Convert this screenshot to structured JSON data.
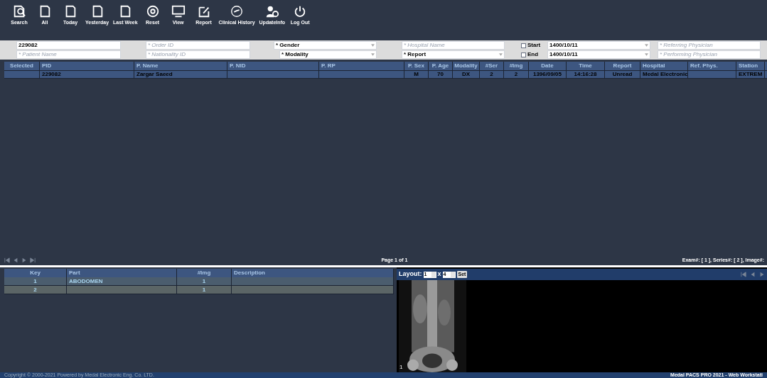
{
  "toolbar": [
    {
      "label": "Search"
    },
    {
      "label": "All"
    },
    {
      "label": "Today"
    },
    {
      "label": "Yesterday"
    },
    {
      "label": "Last Week"
    },
    {
      "label": "Reset"
    },
    {
      "label": "View"
    },
    {
      "label": "Report"
    },
    {
      "label": "Clinical History"
    },
    {
      "label": "UpdateInfo"
    },
    {
      "label": "Log Out"
    }
  ],
  "filters": {
    "row1": [
      {
        "kind": "text",
        "value": "229082"
      },
      {
        "kind": "text",
        "placeholder": "* Order ID"
      },
      {
        "kind": "select",
        "value": "* Gender"
      },
      {
        "kind": "text",
        "placeholder": "* Hospital Name"
      },
      {
        "kind": "date",
        "label": "Start",
        "checked": false,
        "value": "1400/10/11"
      },
      {
        "kind": "text",
        "placeholder": "* Referring Physician"
      }
    ],
    "row2": [
      {
        "kind": "text",
        "placeholder": "* Patient Name"
      },
      {
        "kind": "text",
        "placeholder": "* Nationality ID"
      },
      {
        "kind": "select",
        "value": "* Modality"
      },
      {
        "kind": "select",
        "value": "* Report"
      },
      {
        "kind": "date",
        "label": "End",
        "checked": false,
        "value": "1400/10/11"
      },
      {
        "kind": "text",
        "placeholder": "* Performing Physician"
      }
    ]
  },
  "studies": {
    "columns": [
      "Selected",
      "PID",
      "P. Name",
      "P. NID",
      "P. RP",
      "P. Sex",
      "P. Age",
      "Modality",
      "#Ser",
      "#Img",
      "Date",
      "Time",
      "Report",
      "Hospital",
      "Ref. Phys.",
      "Station"
    ],
    "rows": [
      {
        "selected": false,
        "cells": [
          "",
          "229082",
          "Zargar Saeed",
          "",
          "",
          "M",
          "70",
          "DX",
          "2",
          "2",
          "1396/09/05",
          "14:16:28",
          "Unread",
          "Medal Electronic",
          "",
          "EXTREM"
        ]
      }
    ],
    "page": "Page 1 of 1",
    "counts": "Exam#: [ 1 ], Series#: [ 2 ], Image#:"
  },
  "series": {
    "columns": [
      "Key",
      "Part",
      "#Img",
      "Description"
    ],
    "rows": [
      {
        "selected": false,
        "cells": [
          "1",
          "ABODOMEN",
          "1",
          ""
        ]
      },
      {
        "selected": true,
        "cells": [
          "2",
          "",
          "1",
          ""
        ]
      }
    ]
  },
  "viewer": {
    "layout_label": "Layout:",
    "rows": "1",
    "x": "x",
    "cols": "4",
    "set": "Set",
    "image_index": "1"
  },
  "footer": {
    "copyright": "Copyright © 2000-2021 Powered by Medal Electronic Eng. Co. LTD.",
    "product": "Medal PACS PRO 2021 - Web Workstati"
  }
}
